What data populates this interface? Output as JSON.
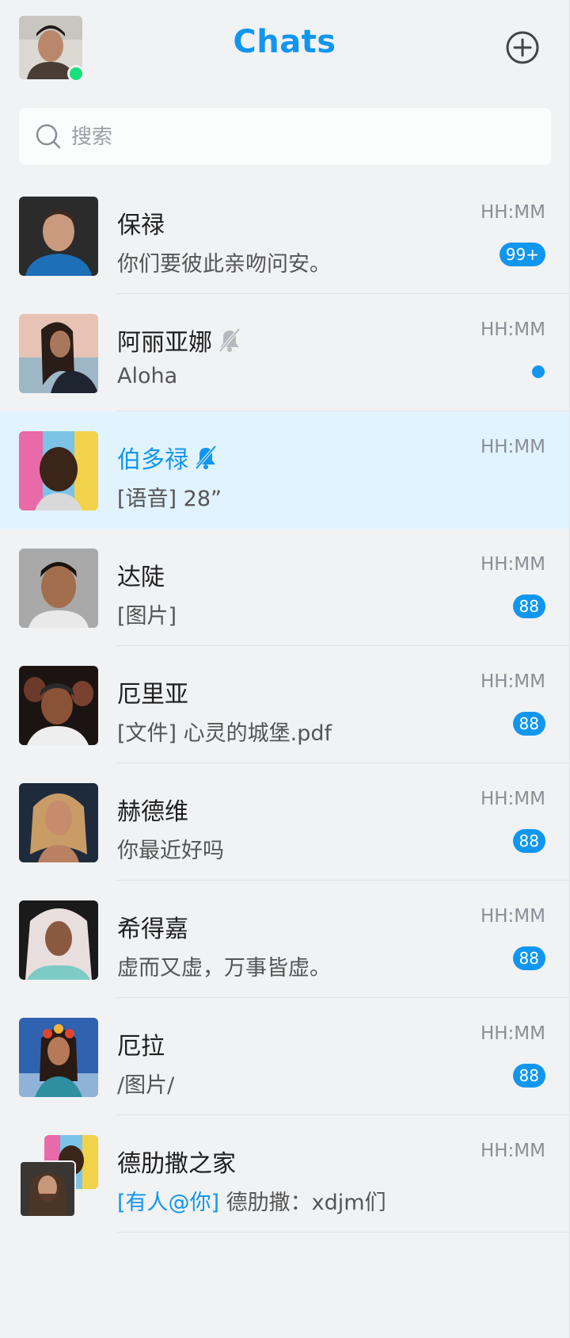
{
  "header": {
    "title": "Chats",
    "add_icon": "plus-circle-icon",
    "status": "online",
    "online_color": "#18e07a"
  },
  "search": {
    "placeholder": "搜索",
    "value": ""
  },
  "colors": {
    "accent": "#1196f0",
    "active_row": "#e1f3fe",
    "background": "#f1f2f4"
  },
  "chats": [
    {
      "name": "保禄",
      "preview": "你们要彼此亲吻问安。",
      "time": "HH:MM",
      "badge": "99+",
      "muted": false,
      "active": false
    },
    {
      "name": "阿丽亚娜",
      "preview": "Aloha",
      "time": "HH:MM",
      "unread_dot": true,
      "muted": true,
      "active": false
    },
    {
      "name": "伯多禄",
      "preview": "[语音] 28”",
      "time": "HH:MM",
      "muted": true,
      "active": true
    },
    {
      "name": "达陡",
      "preview": "[图片]",
      "time": "HH:MM",
      "badge": "88",
      "muted": false,
      "active": false
    },
    {
      "name": "厄里亚",
      "preview": "[文件] 心灵的城堡.pdf",
      "time": "HH:MM",
      "badge": "88",
      "muted": false,
      "active": false
    },
    {
      "name": "赫德维",
      "preview": "你最近好吗",
      "time": "HH:MM",
      "badge": "88",
      "muted": false,
      "active": false
    },
    {
      "name": "希得嘉",
      "preview": "虚而又虚，万事皆虚。",
      "time": "HH:MM",
      "badge": "88",
      "muted": false,
      "active": false
    },
    {
      "name": "厄拉",
      "preview": "/图片/",
      "time": "HH:MM",
      "badge": "88",
      "muted": false,
      "active": false
    },
    {
      "name": "德肋撒之家",
      "mention": "[有人@你]",
      "preview": "德肋撒：xdjm们",
      "time": "HH:MM",
      "muted": false,
      "active": false,
      "group": true
    }
  ]
}
